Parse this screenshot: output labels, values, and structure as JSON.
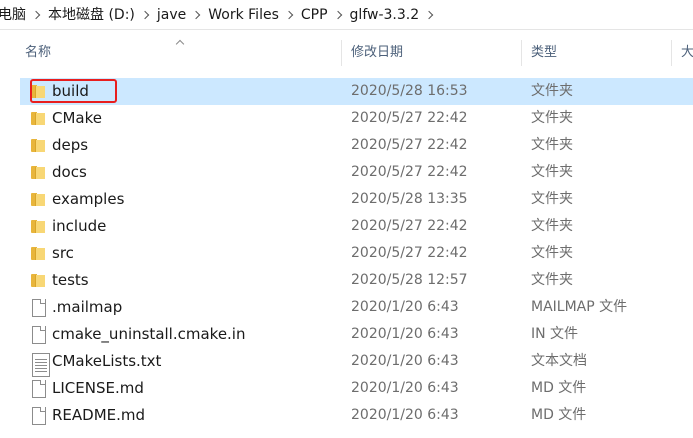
{
  "breadcrumb": [
    "电脑",
    "本地磁盘 (D:)",
    "jave",
    "Work Files",
    "CPP",
    "glfw-3.3.2"
  ],
  "columns": {
    "name": "名称",
    "date": "修改日期",
    "type": "类型",
    "size": "大"
  },
  "files": [
    {
      "name": "build",
      "date": "2020/5/28 16:53",
      "type": "文件夹",
      "icon": "folder",
      "selected": true
    },
    {
      "name": "CMake",
      "date": "2020/5/27 22:42",
      "type": "文件夹",
      "icon": "folder"
    },
    {
      "name": "deps",
      "date": "2020/5/27 22:42",
      "type": "文件夹",
      "icon": "folder"
    },
    {
      "name": "docs",
      "date": "2020/5/27 22:42",
      "type": "文件夹",
      "icon": "folder"
    },
    {
      "name": "examples",
      "date": "2020/5/28 13:35",
      "type": "文件夹",
      "icon": "folder"
    },
    {
      "name": "include",
      "date": "2020/5/27 22:42",
      "type": "文件夹",
      "icon": "folder"
    },
    {
      "name": "src",
      "date": "2020/5/27 22:42",
      "type": "文件夹",
      "icon": "folder"
    },
    {
      "name": "tests",
      "date": "2020/5/28 12:57",
      "type": "文件夹",
      "icon": "folder"
    },
    {
      "name": ".mailmap",
      "date": "2020/1/20 6:43",
      "type": "MAILMAP 文件",
      "icon": "file"
    },
    {
      "name": "cmake_uninstall.cmake.in",
      "date": "2020/1/20 6:43",
      "type": "IN 文件",
      "icon": "file"
    },
    {
      "name": "CMakeLists.txt",
      "date": "2020/1/20 6:43",
      "type": "文本文档",
      "icon": "text-document"
    },
    {
      "name": "LICENSE.md",
      "date": "2020/1/20 6:43",
      "type": "MD 文件",
      "icon": "file"
    },
    {
      "name": "README.md",
      "date": "2020/1/20 6:43",
      "type": "MD 文件",
      "icon": "file"
    }
  ],
  "colors": {
    "selection": "#cce8ff",
    "annotation": "#e81e1e",
    "folder": "#f8d775"
  }
}
